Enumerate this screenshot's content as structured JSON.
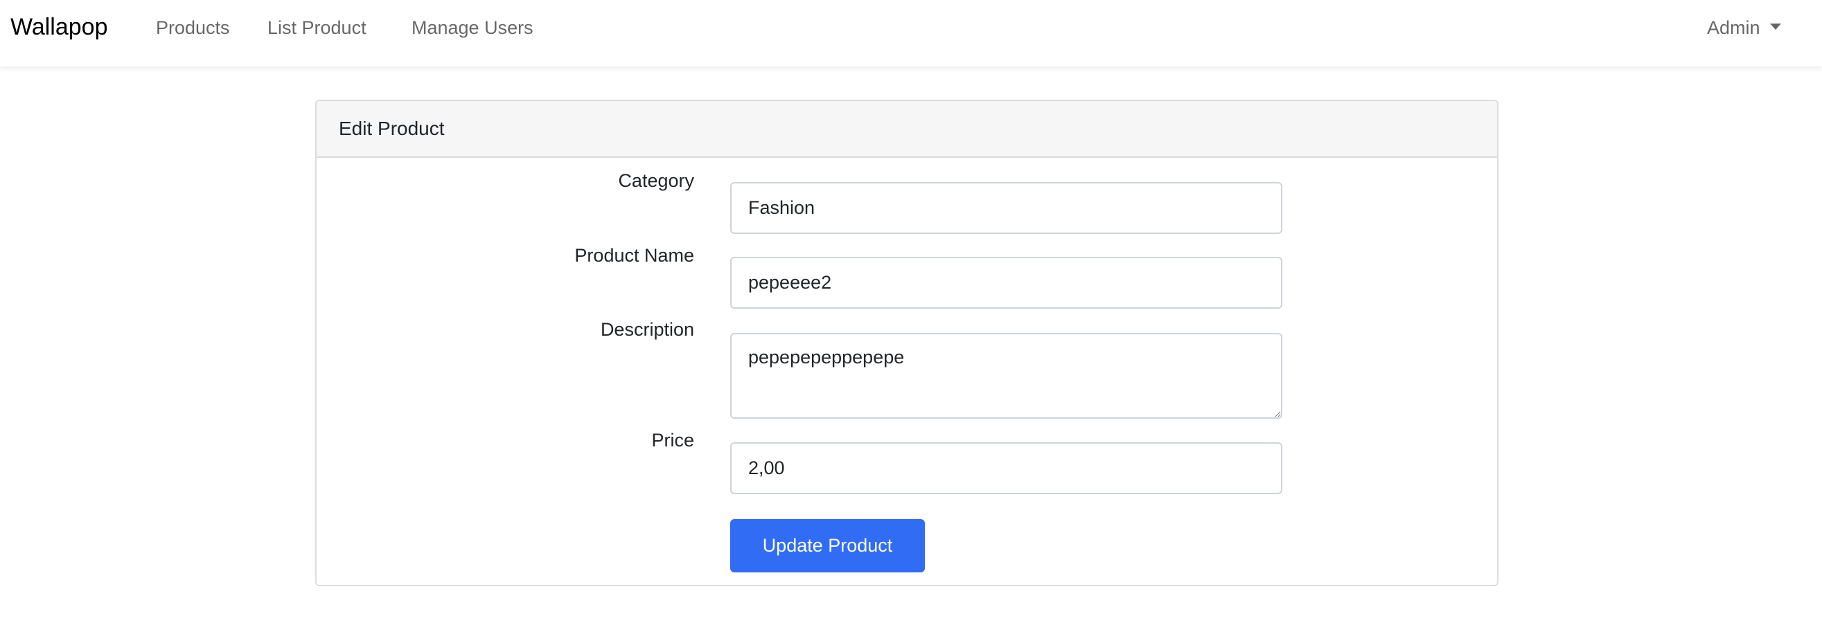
{
  "navbar": {
    "brand": "Wallapop",
    "links": [
      "Products",
      "List Product",
      "Manage Users"
    ],
    "user_menu": "Admin"
  },
  "card": {
    "title": "Edit Product",
    "fields": {
      "category": {
        "label": "Category",
        "value": "Fashion"
      },
      "product_name": {
        "label": "Product Name",
        "value": "pepeeee2"
      },
      "description": {
        "label": "Description",
        "value": "pepepepeppepepe"
      },
      "price": {
        "label": "Price",
        "value": "2,00"
      }
    },
    "submit_label": "Update Product"
  },
  "colors": {
    "primary": "#316cf4",
    "header_bg": "#f6f6f6"
  }
}
